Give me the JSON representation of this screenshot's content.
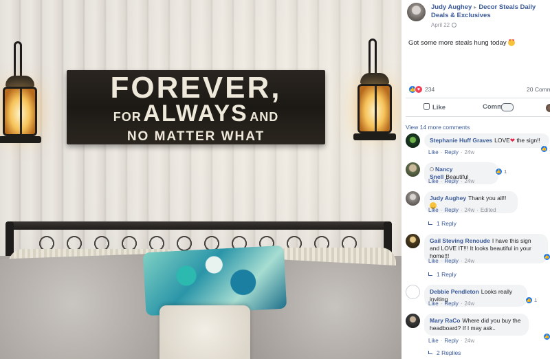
{
  "photo": {
    "sign": {
      "line1": "FOREVER,",
      "line2_a": "FOR",
      "line2_b": "ALWAYS",
      "line2_c": "AND",
      "line3": "NO MATTER WHAT"
    }
  },
  "post": {
    "author": "Judy Aughey",
    "arrow": "▸",
    "group": "Decor Steals Daily Deals & Exclusives",
    "date": "April 22",
    "text": "Got some more steals hung today",
    "reaction_count": "234",
    "comment_count": "20 Comm",
    "like_label": "Like",
    "comment_label": "Comment"
  },
  "comments_section": {
    "view_more": "View 14 more comments",
    "comments": [
      {
        "name": "Stephanie Huff Graves",
        "text": "LOVE",
        "text_after": " the sign!!",
        "like": "Like",
        "reply": "Reply",
        "time": "24w",
        "reactions": "1"
      },
      {
        "name": "Nancy Snell",
        "text": "Beautiful",
        "like": "Like",
        "reply": "Reply",
        "time": "24w",
        "reactions": "1"
      },
      {
        "name": "Judy Aughey",
        "text": "Thank you all!!",
        "like": "Like",
        "reply": "Reply",
        "time": "24w",
        "edited": "Edited",
        "replies": "1 Reply"
      },
      {
        "name": "Gail Steving Renoude",
        "text": "I have this sign and LOVE IT!!! It looks beautiful in your home!!!",
        "like": "Like",
        "reply": "Reply",
        "time": "24w",
        "replies": "1 Reply"
      },
      {
        "name": "Debbie Pendleton",
        "text": "Looks really inviting",
        "like": "Like",
        "reply": "Reply",
        "time": "24w",
        "reactions": "1"
      },
      {
        "name": "Mary RaCo",
        "text": "Where did you buy the headboard? If I may ask..",
        "like": "Like",
        "reply": "Reply",
        "time": "24w",
        "replies": "2 Replies"
      }
    ]
  },
  "colors": {
    "link": "#385898",
    "meta": "#90949c",
    "bubble": "#f2f3f5",
    "like_blue": "#1877f2",
    "love_red": "#f33e58"
  },
  "icons": [
    "globe-icon",
    "like-reaction-icon",
    "love-reaction-icon",
    "thumbs-up-icon",
    "comment-icon",
    "heart-eyes-emoji",
    "smile-emoji",
    "reply-arrow-icon"
  ]
}
